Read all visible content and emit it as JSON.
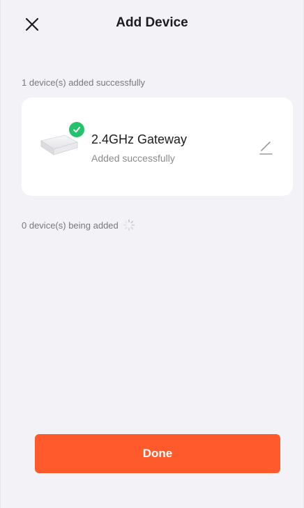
{
  "header": {
    "title": "Add Device",
    "close_icon": "close-icon"
  },
  "added_section": {
    "label": "1 device(s) added successfully"
  },
  "device": {
    "name": "2.4GHz Gateway",
    "status": "Added successfully",
    "badge_icon": "check-circle-icon",
    "edit_icon": "pencil-edit-icon"
  },
  "adding_section": {
    "label": "0 device(s) being added",
    "icon": "loading-spinner-icon"
  },
  "footer": {
    "done_label": "Done"
  },
  "colors": {
    "background": "#f3f3f7",
    "accent": "#ff5a2c",
    "success": "#23c26b"
  }
}
